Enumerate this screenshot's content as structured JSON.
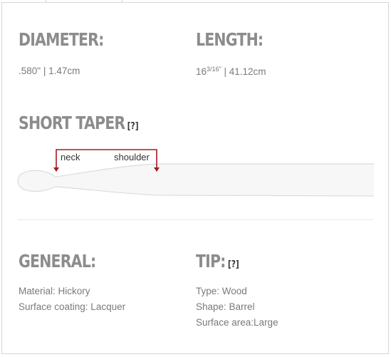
{
  "specs": {
    "diameter": {
      "label": "DIAMETER:",
      "value": ".580\" | 1.47cm"
    },
    "length": {
      "label": "LENGTH:",
      "value_whole": "16",
      "value_fraction": "3/16\"",
      "value_rest": " | 41.12cm"
    }
  },
  "taper": {
    "label": "SHORT TAPER",
    "help": "[?]",
    "neck_label": "neck",
    "shoulder_label": "shoulder",
    "arrow_color": "#a31b22"
  },
  "general": {
    "label": "GENERAL:",
    "items": [
      "Material: Hickory",
      "Surface coating: Lacquer"
    ]
  },
  "tip": {
    "label": "TIP:",
    "help": "[?]",
    "items": [
      "Type: Wood",
      "Shape: Barrel",
      "Surface area:Large"
    ]
  }
}
